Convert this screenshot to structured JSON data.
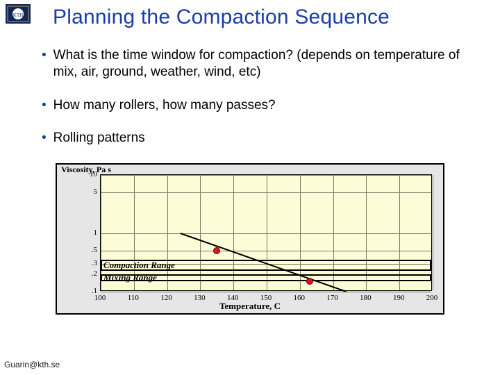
{
  "title": "Planning the Compaction Sequence",
  "bullets": [
    "What is the time window for compaction? (depends on temperature of mix, air, ground, weather, wind, etc)",
    "How many rollers, how many passes?",
    "Rolling patterns"
  ],
  "footer": "Guarin@kth.se",
  "chart_data": {
    "type": "scatter",
    "title": "",
    "xlabel": "Temperature, C",
    "ylabel": "Viscosity, Pa s",
    "xlim": [
      100,
      200
    ],
    "ylim_log": [
      0.1,
      10
    ],
    "xticks": [
      100,
      110,
      120,
      130,
      140,
      150,
      160,
      170,
      180,
      190,
      200
    ],
    "yticks": [
      0.1,
      0.2,
      0.3,
      0.5,
      1,
      5,
      10
    ],
    "bands": [
      {
        "label": "Compaction Range",
        "ymin": 0.23,
        "ymax": 0.35
      },
      {
        "label": "Mixing Range",
        "ymin": 0.15,
        "ymax": 0.2
      }
    ],
    "points": [
      {
        "x": 135,
        "y": 0.5
      },
      {
        "x": 163,
        "y": 0.15
      }
    ],
    "fit_line": {
      "x1": 124,
      "y1": 1.0,
      "x2": 174,
      "y2": 0.1
    }
  }
}
